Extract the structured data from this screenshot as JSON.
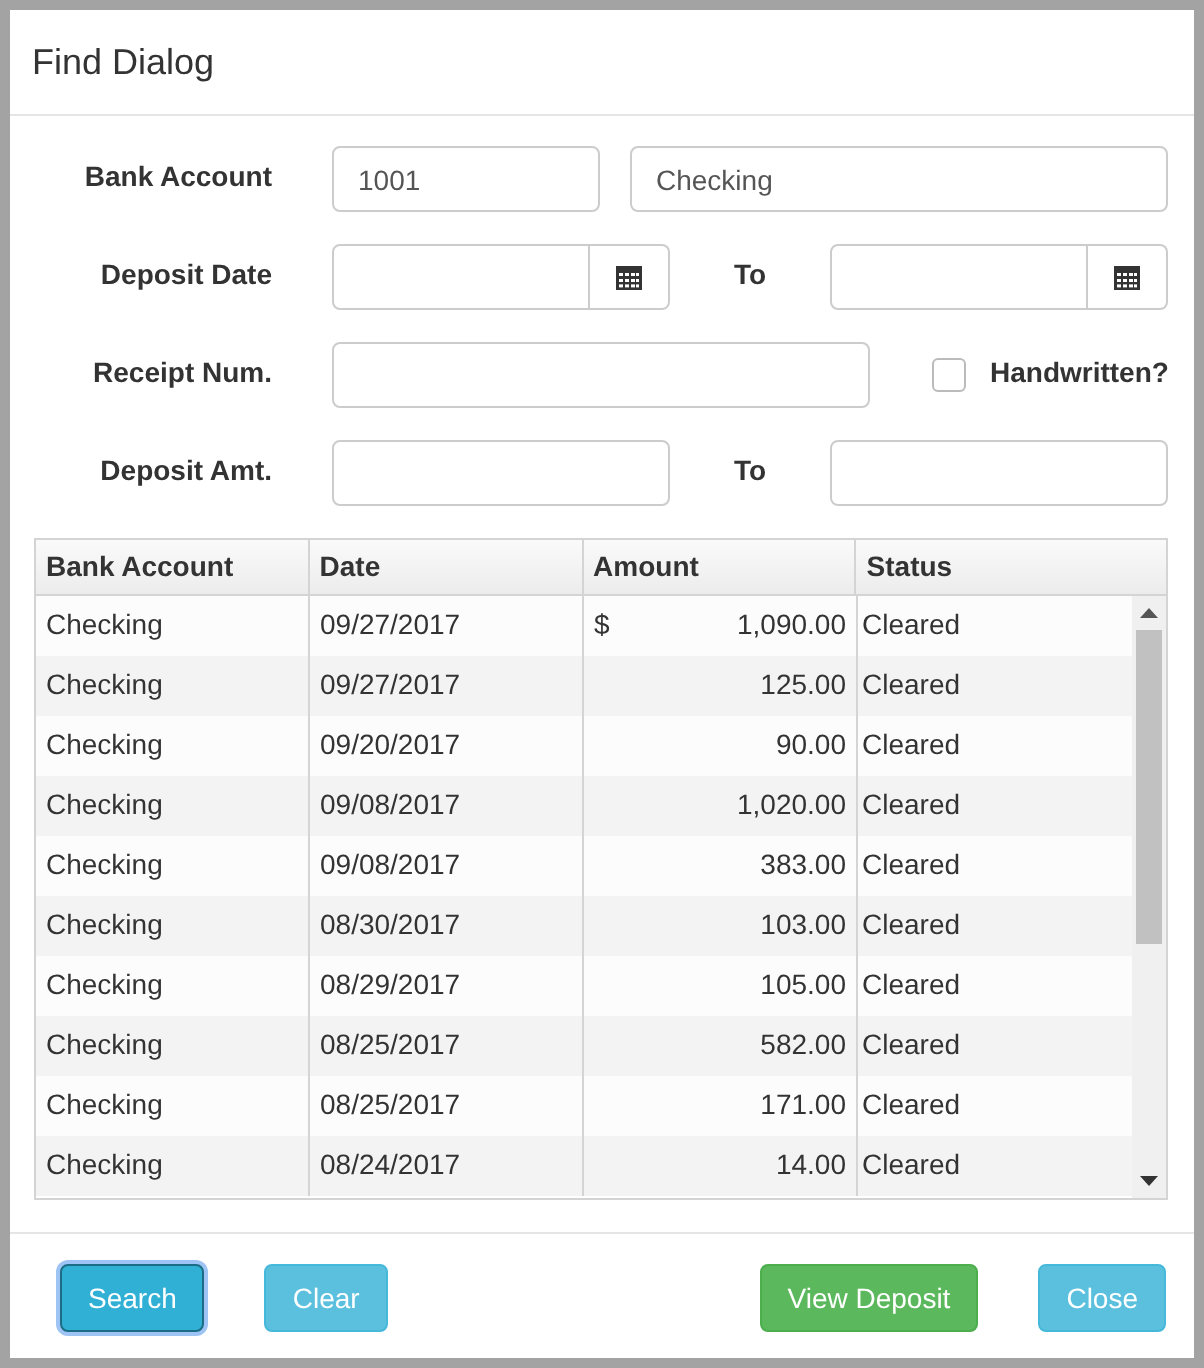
{
  "dialog": {
    "title": "Find Dialog"
  },
  "form": {
    "bank_account": {
      "label": "Bank Account",
      "code": "1001",
      "name": "Checking"
    },
    "deposit_date": {
      "label": "Deposit Date",
      "to_label": "To"
    },
    "receipt_num": {
      "label": "Receipt Num."
    },
    "handwritten": {
      "label": "Handwritten?",
      "checked": false
    },
    "deposit_amt": {
      "label": "Deposit Amt.",
      "to_label": "To"
    }
  },
  "table": {
    "columns": [
      "Bank Account",
      "Date",
      "Amount",
      "Status"
    ],
    "rows": [
      {
        "account": "Checking",
        "date": "09/27/2017",
        "currency": "$",
        "amount": "1,090.00",
        "status": "Cleared"
      },
      {
        "account": "Checking",
        "date": "09/27/2017",
        "amount": "125.00",
        "status": "Cleared"
      },
      {
        "account": "Checking",
        "date": "09/20/2017",
        "amount": "90.00",
        "status": "Cleared"
      },
      {
        "account": "Checking",
        "date": "09/08/2017",
        "amount": "1,020.00",
        "status": "Cleared"
      },
      {
        "account": "Checking",
        "date": "09/08/2017",
        "amount": "383.00",
        "status": "Cleared"
      },
      {
        "account": "Checking",
        "date": "08/30/2017",
        "amount": "103.00",
        "status": "Cleared"
      },
      {
        "account": "Checking",
        "date": "08/29/2017",
        "amount": "105.00",
        "status": "Cleared"
      },
      {
        "account": "Checking",
        "date": "08/25/2017",
        "amount": "582.00",
        "status": "Cleared"
      },
      {
        "account": "Checking",
        "date": "08/25/2017",
        "amount": "171.00",
        "status": "Cleared"
      },
      {
        "account": "Checking",
        "date": "08/24/2017",
        "amount": "14.00",
        "status": "Cleared"
      }
    ]
  },
  "buttons": [
    {
      "label": "Search",
      "kind": "info",
      "focused": true
    },
    {
      "label": "Clear",
      "kind": "info",
      "focused": false
    },
    {
      "label": "View Deposit",
      "kind": "success",
      "focused": false
    },
    {
      "label": "Close",
      "kind": "info",
      "focused": false
    }
  ]
}
